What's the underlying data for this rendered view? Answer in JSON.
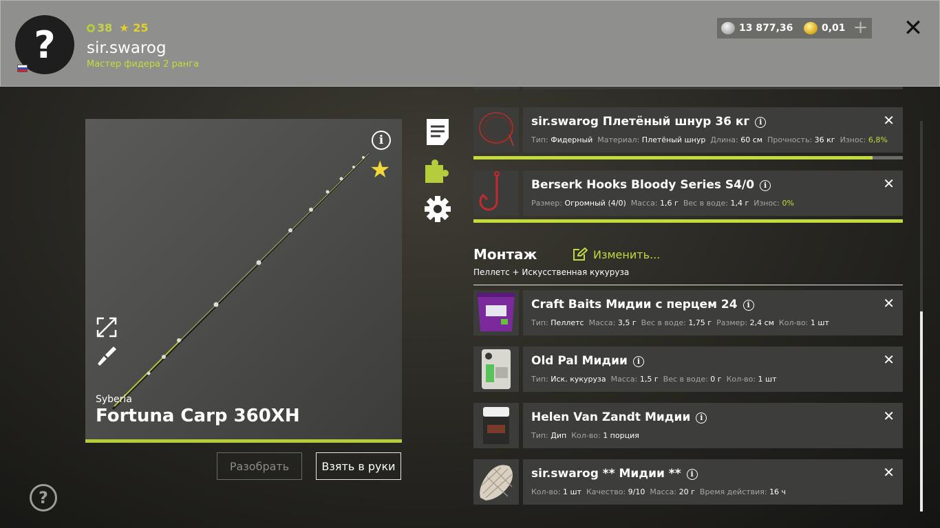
{
  "header": {
    "level": "38",
    "stars": "25",
    "username": "sir.swarog",
    "rank": "Мастер фидера 2 ранга",
    "silver": "13 877,36",
    "gold": "0,01",
    "plus_label": "+",
    "close_label": "✕"
  },
  "rod": {
    "brand": "Syberia",
    "name": "Fortuna Carp 360XH",
    "info_label": "i",
    "fav_label": "★"
  },
  "actions": {
    "disassemble": "Разобрать",
    "take": "Взять в руки"
  },
  "help_label": "?",
  "line_item": {
    "title": "sir.swarog Плетёный шнур 36 кг",
    "props": [
      {
        "k": "Тип:",
        "v": "Фидерный"
      },
      {
        "k": "Материал:",
        "v": "Плетёный шнур"
      },
      {
        "k": "Длина:",
        "v": "60 см"
      },
      {
        "k": "Прочность:",
        "v": "36 кг"
      },
      {
        "k": "Износ:",
        "v": "6,8%"
      }
    ],
    "condition_fraction": 0.93
  },
  "hook_item": {
    "title": "Berserk Hooks Bloody Series S4/0",
    "props": [
      {
        "k": "Размер:",
        "v": "Огромный (4/0)"
      },
      {
        "k": "Масса:",
        "v": "1,6 г"
      },
      {
        "k": "Вес в воде:",
        "v": "1,4 г"
      },
      {
        "k": "Износ:",
        "v": "0%"
      }
    ],
    "condition_fraction": 1.0
  },
  "rig": {
    "title": "Монтаж",
    "edit_label": "Изменить...",
    "subtitle": "Пеллетс + Искусственная кукуруза"
  },
  "bait1": {
    "title": "Craft Baits Мидии с перцем 24",
    "props": [
      {
        "k": "Тип:",
        "v": "Пеллетс"
      },
      {
        "k": "Масса:",
        "v": "3,5 г"
      },
      {
        "k": "Вес в воде:",
        "v": "1,75 г"
      },
      {
        "k": "Размер:",
        "v": "2,4 см"
      },
      {
        "k": "Кол-во:",
        "v": "1 шт"
      }
    ],
    "thumb_label": "CraftBaits"
  },
  "bait2": {
    "title": "Old Pal Мидии",
    "props": [
      {
        "k": "Тип:",
        "v": "Иск. кукуруза"
      },
      {
        "k": "Масса:",
        "v": "1,5 г"
      },
      {
        "k": "Вес в воде:",
        "v": "0 г"
      },
      {
        "k": "Кол-во:",
        "v": "1 шт"
      }
    ]
  },
  "dip": {
    "title": "Helen Van Zandt Мидии",
    "props": [
      {
        "k": "Тип:",
        "v": "Дип"
      },
      {
        "k": "Кол-во:",
        "v": "1 порция"
      }
    ]
  },
  "feed": {
    "title": "sir.swarog ** Мидии **",
    "props": [
      {
        "k": "Кол-во:",
        "v": "1 шт"
      },
      {
        "k": "Качество:",
        "v": "9/10"
      },
      {
        "k": "Масса:",
        "v": "20 г"
      },
      {
        "k": "Время действия:",
        "v": "16 ч"
      }
    ]
  },
  "remove_label": "✕",
  "colors": {
    "accent": "#c4dc3a",
    "header_bg": "#8f8f8d",
    "card_bg": "#3d3d3b"
  }
}
